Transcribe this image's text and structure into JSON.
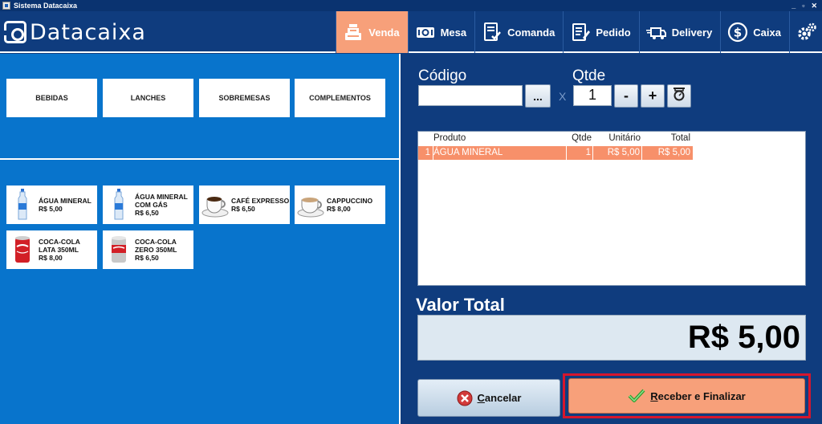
{
  "window": {
    "title": "Sistema Datacaixa",
    "controls": [
      "_",
      "▫",
      "✕"
    ]
  },
  "brand": {
    "name": "Datacaixa"
  },
  "nav": [
    {
      "label": "Venda",
      "icon": "cash-register-icon",
      "active": true
    },
    {
      "label": "Mesa",
      "icon": "table-icon",
      "active": false
    },
    {
      "label": "Comanda",
      "icon": "checklist-icon",
      "active": false
    },
    {
      "label": "Pedido",
      "icon": "order-icon",
      "active": false
    },
    {
      "label": "Delivery",
      "icon": "delivery-truck-icon",
      "active": false
    },
    {
      "label": "Caixa",
      "icon": "dollar-icon",
      "active": false
    },
    {
      "label": "",
      "icon": "gears-icon",
      "active": false
    }
  ],
  "categories": [
    "BEBIDAS",
    "LANCHES",
    "SOBREMESAS",
    "COMPLEMENTOS"
  ],
  "products": [
    {
      "name_lines": [
        "ÁGUA MINERAL"
      ],
      "price": "R$ 5,00",
      "icon": "water-bottle-icon"
    },
    {
      "name_lines": [
        "ÁGUA MINERAL",
        "COM GÁS"
      ],
      "price": "R$ 6,50",
      "icon": "water-bottle-icon"
    },
    {
      "name_lines": [
        "CAFÉ EXPRESSO"
      ],
      "price": "R$ 6,50",
      "icon": "coffee-cup-icon"
    },
    {
      "name_lines": [
        "CAPPUCCINO"
      ],
      "price": "R$ 8,00",
      "icon": "coffee-cup-icon"
    },
    {
      "name_lines": [
        "COCA-COLA",
        "LATA 350ML"
      ],
      "price": "R$ 8,00",
      "icon": "soda-can-red-icon"
    },
    {
      "name_lines": [
        "COCA-COLA",
        "ZERO 350ML"
      ],
      "price": "R$ 6,50",
      "icon": "soda-can-silver-icon"
    }
  ],
  "entry": {
    "code_label": "Código",
    "code_value": "",
    "dots_label": "...",
    "times": "X",
    "qty_label": "Qtde",
    "qty_value": "1",
    "minus": "-",
    "plus": "+"
  },
  "grid": {
    "columns": [
      "",
      "Produto",
      "Qtde",
      "Unitário",
      "Total"
    ],
    "rows": [
      {
        "n": "1",
        "produto": "ÁGUA MINERAL",
        "qtde": "1",
        "unitario": "R$ 5,00",
        "total": "R$ 5,00"
      }
    ]
  },
  "total": {
    "label": "Valor Total",
    "value": "R$ 5,00"
  },
  "actions": {
    "cancel_first": "C",
    "cancel_rest": "ancelar",
    "finish_first": "R",
    "finish_rest": "eceber e Finalizar"
  },
  "colors": {
    "bg": "#0f3c7e",
    "left_panel": "#0874cc",
    "accent": "#f7a07a",
    "highlight_border": "#d6162d"
  }
}
